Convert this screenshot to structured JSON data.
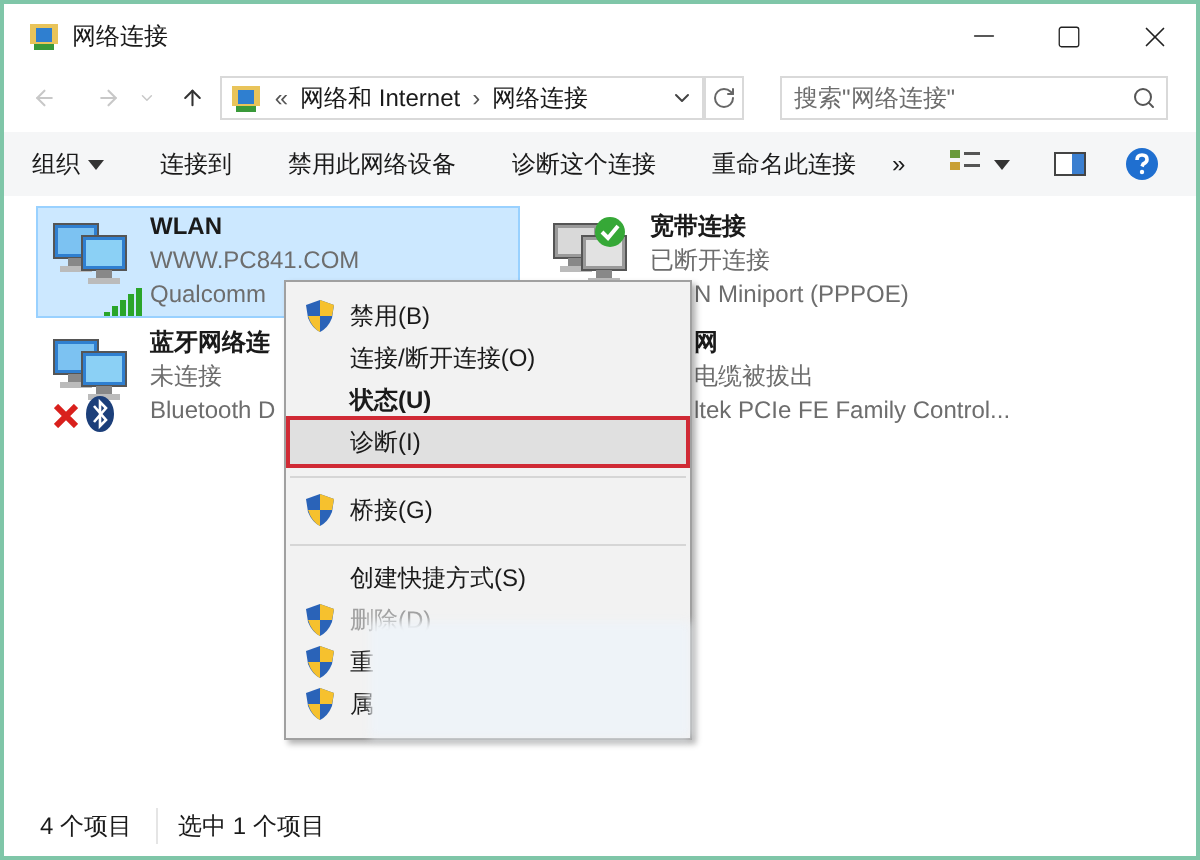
{
  "window": {
    "title": "网络连接"
  },
  "nav": {
    "prefix": "«",
    "path": [
      "网络和 Internet",
      "网络连接"
    ],
    "separator": "›"
  },
  "search": {
    "placeholder": "搜索\"网络连接\""
  },
  "toolbar": {
    "items": [
      {
        "label": "组织",
        "dropdown": true
      },
      {
        "label": "连接到",
        "dropdown": false
      },
      {
        "label": "禁用此网络设备",
        "dropdown": false
      },
      {
        "label": "诊断这个连接",
        "dropdown": false
      },
      {
        "label": "重命名此连接",
        "dropdown": false
      }
    ],
    "overflow": "»"
  },
  "connections": [
    {
      "kind": "wifi",
      "name": "WLAN",
      "status": "WWW.PC841.COM",
      "device": "Qualcomm",
      "selected": true
    },
    {
      "kind": "broadband",
      "name": "宽带连接",
      "status": "已断开连接",
      "device": "N Miniport (PPPOE)",
      "selected": false
    },
    {
      "kind": "bluetooth",
      "name": "蓝牙网络连",
      "status": "未连接",
      "device": "Bluetooth D",
      "selected": false
    },
    {
      "kind": "ethernet",
      "name": "网",
      "status": "电缆被拔出",
      "device": "ltek PCIe FE Family Control...",
      "selected": false
    }
  ],
  "context_menu": [
    {
      "kind": "item",
      "label": "禁用(B)",
      "shield": true,
      "bold": false,
      "disabled": false,
      "selected": false
    },
    {
      "kind": "item",
      "label": "连接/断开连接(O)",
      "shield": false,
      "bold": false,
      "disabled": false,
      "selected": false
    },
    {
      "kind": "item",
      "label": "状态(U)",
      "shield": false,
      "bold": true,
      "disabled": false,
      "selected": false
    },
    {
      "kind": "item",
      "label": "诊断(I)",
      "shield": false,
      "bold": false,
      "disabled": false,
      "selected": true
    },
    {
      "kind": "separator"
    },
    {
      "kind": "item",
      "label": "桥接(G)",
      "shield": true,
      "bold": false,
      "disabled": false,
      "selected": false
    },
    {
      "kind": "separator"
    },
    {
      "kind": "item",
      "label": "创建快捷方式(S)",
      "shield": false,
      "bold": false,
      "disabled": false,
      "selected": false
    },
    {
      "kind": "item",
      "label": "删除(D)",
      "shield": true,
      "bold": false,
      "disabled": true,
      "selected": false
    },
    {
      "kind": "item",
      "label": "重",
      "shield": true,
      "bold": false,
      "disabled": false,
      "selected": false
    },
    {
      "kind": "item",
      "label": "属",
      "shield": true,
      "bold": false,
      "disabled": false,
      "selected": false
    }
  ],
  "status_bar": [
    "4 个项目",
    "选中 1 个项目"
  ]
}
